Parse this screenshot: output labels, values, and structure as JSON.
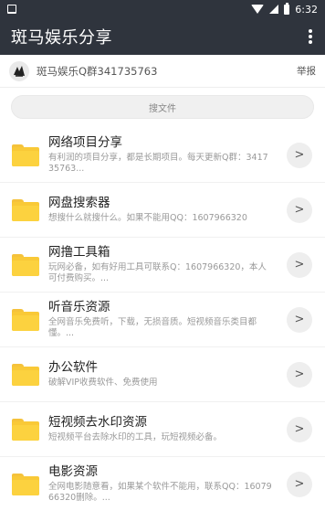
{
  "status_bar": {
    "time": "6:32"
  },
  "app_bar": {
    "title": "斑马娱乐分享"
  },
  "group": {
    "text": "斑马娱乐Q群341735763",
    "report_label": "举报"
  },
  "search": {
    "placeholder": "搜文件"
  },
  "items": [
    {
      "title": "网络项目分享",
      "desc": "有利润的项目分享，都是长期项目。每天更新Q群：341735763..."
    },
    {
      "title": "网盘搜索器",
      "desc": "想搜什么就搜什么。如果不能用QQ：1607966320"
    },
    {
      "title": "网撸工具箱",
      "desc": "玩网必备，如有好用工具可联系Q：1607966320，本人可付费购买。..."
    },
    {
      "title": "听音乐资源",
      "desc": "全网音乐免费听，下载，无损音质。短视频音乐类目都懂。..."
    },
    {
      "title": "办公软件",
      "desc": "破解VIP收费软件、免费使用"
    },
    {
      "title": "短视频去水印资源",
      "desc": "短视频平台去除水印的工具，玩短视频必备。"
    },
    {
      "title": "电影资源",
      "desc": "全网电影随意看，如果某个软件不能用，联系QQ：1607966320删除。..."
    }
  ]
}
